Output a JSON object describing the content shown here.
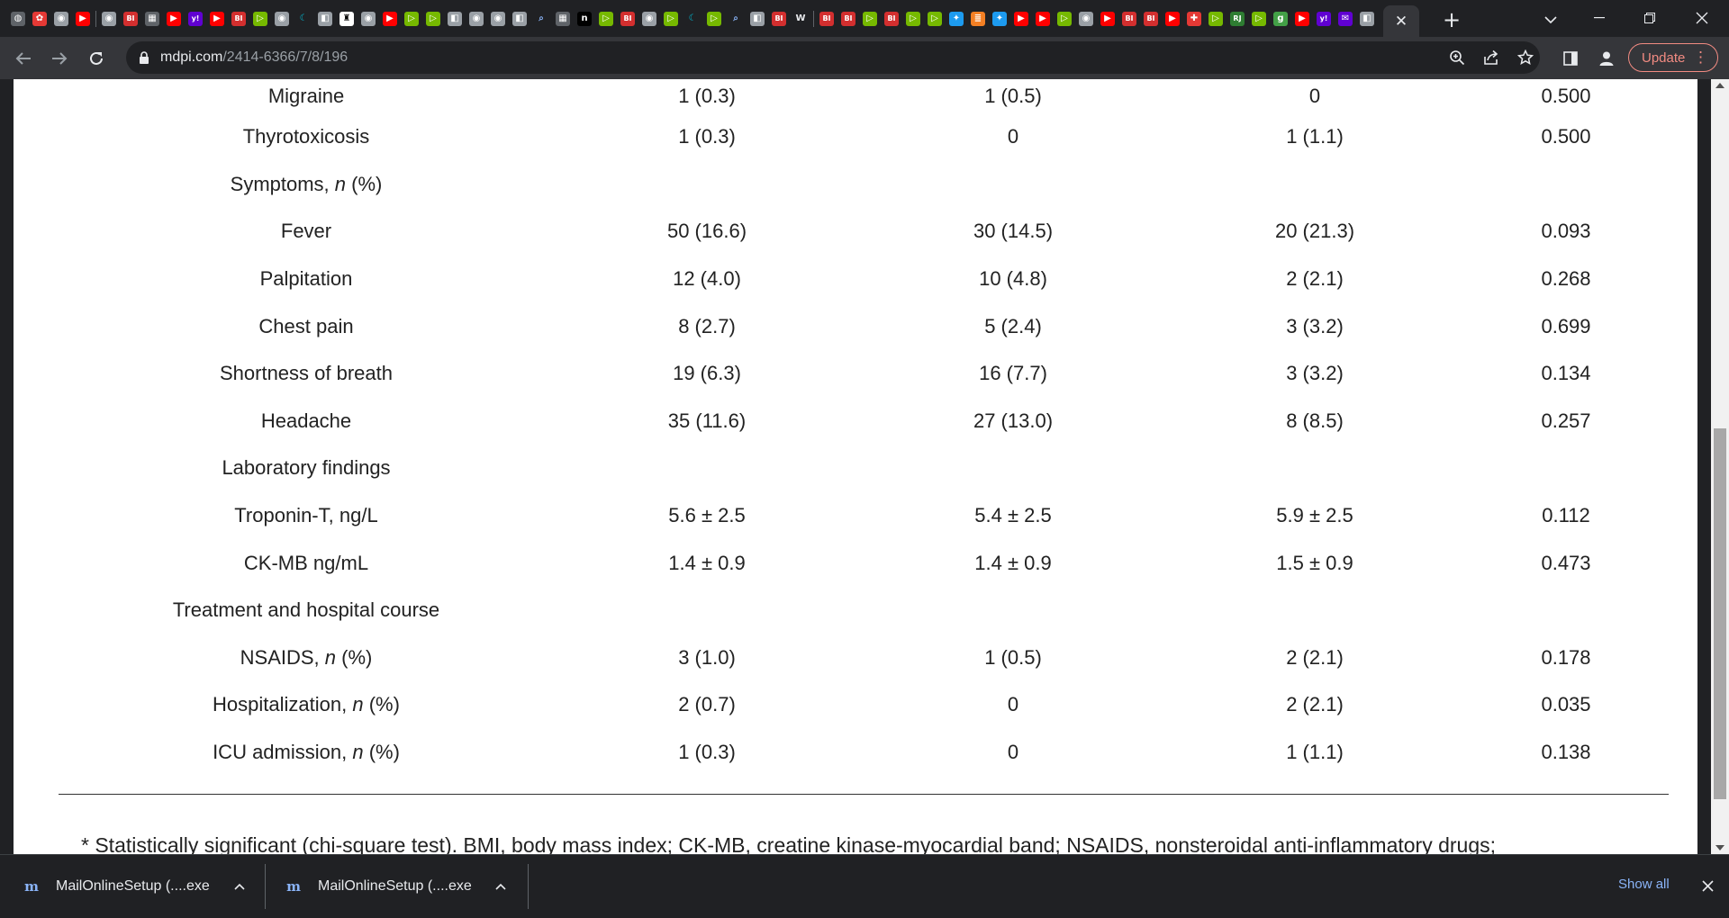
{
  "browser": {
    "tab_favicons": [
      {
        "name": "globe",
        "bg": "#5f6368",
        "glyph": "◍"
      },
      {
        "name": "flower",
        "bg": "#e53935",
        "glyph": "✿"
      },
      {
        "name": "chrome",
        "bg": "#9aa0a6",
        "glyph": "◉"
      },
      {
        "name": "youtube",
        "bg": "#ff0000",
        "glyph": "▶"
      },
      {
        "name": "sep"
      },
      {
        "name": "chrome",
        "bg": "#9aa0a6",
        "glyph": "◉"
      },
      {
        "name": "bi",
        "bg": "#d32f2f",
        "glyph": "BI"
      },
      {
        "name": "tablet",
        "bg": "#5f6368",
        "glyph": "▦"
      },
      {
        "name": "youtube",
        "bg": "#ff0000",
        "glyph": "▶"
      },
      {
        "name": "yahoo",
        "bg": "#6001d2",
        "glyph": "y!"
      },
      {
        "name": "youtube",
        "bg": "#ff0000",
        "glyph": "▶"
      },
      {
        "name": "bi",
        "bg": "#d32f2f",
        "glyph": "BI"
      },
      {
        "name": "play",
        "bg": "#76b900",
        "glyph": "▷"
      },
      {
        "name": "chrome",
        "bg": "#9aa0a6",
        "glyph": "◉"
      },
      {
        "name": "cyan",
        "bg": "#202124",
        "glyph": "☾"
      },
      {
        "name": "doc",
        "bg": "#9aa0a6",
        "glyph": "◧"
      },
      {
        "name": "chess",
        "bg": "#ffffff",
        "glyph": "♜"
      },
      {
        "name": "chrome",
        "bg": "#9aa0a6",
        "glyph": "◉"
      },
      {
        "name": "youtube",
        "bg": "#ff0000",
        "glyph": "▶"
      },
      {
        "name": "play",
        "bg": "#76b900",
        "glyph": "▷"
      },
      {
        "name": "play",
        "bg": "#76b900",
        "glyph": "▷"
      },
      {
        "name": "doc",
        "bg": "#9aa0a6",
        "glyph": "◧"
      },
      {
        "name": "chrome",
        "bg": "#9aa0a6",
        "glyph": "◉"
      },
      {
        "name": "chrome",
        "bg": "#9aa0a6",
        "glyph": "◉"
      },
      {
        "name": "doc",
        "bg": "#9aa0a6",
        "glyph": "◧"
      },
      {
        "name": "search",
        "bg": "#202124",
        "glyph": "⌕"
      },
      {
        "name": "tablet",
        "bg": "#5f6368",
        "glyph": "▦"
      },
      {
        "name": "n",
        "bg": "#000000",
        "glyph": "n"
      },
      {
        "name": "play",
        "bg": "#76b900",
        "glyph": "▷"
      },
      {
        "name": "bi",
        "bg": "#d32f2f",
        "glyph": "BI"
      },
      {
        "name": "chrome",
        "bg": "#9aa0a6",
        "glyph": "◉"
      },
      {
        "name": "play",
        "bg": "#76b900",
        "glyph": "▷"
      },
      {
        "name": "cyan",
        "bg": "#202124",
        "glyph": "☾"
      },
      {
        "name": "play",
        "bg": "#76b900",
        "glyph": "▷"
      },
      {
        "name": "search",
        "bg": "#202124",
        "glyph": "⌕"
      },
      {
        "name": "doc",
        "bg": "#9aa0a6",
        "glyph": "◧"
      },
      {
        "name": "bi",
        "bg": "#d32f2f",
        "glyph": "BI"
      },
      {
        "name": "wiki",
        "bg": "#202124",
        "glyph": "W"
      },
      {
        "name": "sep"
      },
      {
        "name": "bi",
        "bg": "#d32f2f",
        "glyph": "BI"
      },
      {
        "name": "bi",
        "bg": "#d32f2f",
        "glyph": "BI"
      },
      {
        "name": "play",
        "bg": "#76b900",
        "glyph": "▷"
      },
      {
        "name": "bi",
        "bg": "#d32f2f",
        "glyph": "BI"
      },
      {
        "name": "play",
        "bg": "#76b900",
        "glyph": "▷"
      },
      {
        "name": "play",
        "bg": "#76b900",
        "glyph": "▷"
      },
      {
        "name": "twitter",
        "bg": "#1d9bf0",
        "glyph": "✦"
      },
      {
        "name": "stack",
        "bg": "#f48024",
        "glyph": "≣"
      },
      {
        "name": "twitter",
        "bg": "#1d9bf0",
        "glyph": "✦"
      },
      {
        "name": "youtube",
        "bg": "#ff0000",
        "glyph": "▶"
      },
      {
        "name": "youtube",
        "bg": "#ff0000",
        "glyph": "▶"
      },
      {
        "name": "play",
        "bg": "#76b900",
        "glyph": "▷"
      },
      {
        "name": "chrome",
        "bg": "#9aa0a6",
        "glyph": "◉"
      },
      {
        "name": "youtube",
        "bg": "#ff0000",
        "glyph": "▶"
      },
      {
        "name": "bi",
        "bg": "#d32f2f",
        "glyph": "BI"
      },
      {
        "name": "bi",
        "bg": "#d32f2f",
        "glyph": "BI"
      },
      {
        "name": "youtube",
        "bg": "#ff0000",
        "glyph": "▶"
      },
      {
        "name": "puzzle",
        "bg": "#e53935",
        "glyph": "✚"
      },
      {
        "name": "play",
        "bg": "#76b900",
        "glyph": "▷"
      },
      {
        "name": "rj",
        "bg": "#2e7d32",
        "glyph": "RJ"
      },
      {
        "name": "play",
        "bg": "#76b900",
        "glyph": "▷"
      },
      {
        "name": "g",
        "bg": "#43a047",
        "glyph": "g"
      },
      {
        "name": "youtube",
        "bg": "#ff0000",
        "glyph": "▶"
      },
      {
        "name": "yahoo",
        "bg": "#6001d2",
        "glyph": "y!"
      },
      {
        "name": "mail",
        "bg": "#6001d2",
        "glyph": "✉"
      },
      {
        "name": "doc",
        "bg": "#9aa0a6",
        "glyph": "◧"
      }
    ],
    "active_tab_close": "✕",
    "new_tab": "+",
    "url_domain": "mdpi.com",
    "url_path": "/2414-6366/7/8/196",
    "update_label": "Update",
    "update_menu": "⋮"
  },
  "table": {
    "rows": [
      {
        "label": "Migraine",
        "label_italic": "",
        "label_suffix": "",
        "c1": "1 (0.3)",
        "c2": "1 (0.5)",
        "c3": "0",
        "p": "0.500"
      },
      {
        "label": "Thyrotoxicosis",
        "label_italic": "",
        "label_suffix": "",
        "c1": "1 (0.3)",
        "c2": "0",
        "c3": "1 (1.1)",
        "p": "0.500"
      },
      {
        "label": "Symptoms, ",
        "label_italic": "n",
        "label_suffix": " (%)",
        "c1": "",
        "c2": "",
        "c3": "",
        "p": ""
      },
      {
        "label": "Fever",
        "label_italic": "",
        "label_suffix": "",
        "c1": "50 (16.6)",
        "c2": "30 (14.5)",
        "c3": "20 (21.3)",
        "p": "0.093"
      },
      {
        "label": "Palpitation",
        "label_italic": "",
        "label_suffix": "",
        "c1": "12 (4.0)",
        "c2": "10 (4.8)",
        "c3": "2 (2.1)",
        "p": "0.268"
      },
      {
        "label": "Chest pain",
        "label_italic": "",
        "label_suffix": "",
        "c1": "8 (2.7)",
        "c2": "5 (2.4)",
        "c3": "3 (3.2)",
        "p": "0.699"
      },
      {
        "label": "Shortness of breath",
        "label_italic": "",
        "label_suffix": "",
        "c1": "19 (6.3)",
        "c2": "16 (7.7)",
        "c3": "3 (3.2)",
        "p": "0.134"
      },
      {
        "label": "Headache",
        "label_italic": "",
        "label_suffix": "",
        "c1": "35 (11.6)",
        "c2": "27 (13.0)",
        "c3": "8 (8.5)",
        "p": "0.257"
      },
      {
        "label": "Laboratory findings",
        "label_italic": "",
        "label_suffix": "",
        "c1": "",
        "c2": "",
        "c3": "",
        "p": ""
      },
      {
        "label": "Troponin-T, ng/L",
        "label_italic": "",
        "label_suffix": "",
        "c1": "5.6 ± 2.5",
        "c2": "5.4 ± 2.5",
        "c3": "5.9 ± 2.5",
        "p": "0.112"
      },
      {
        "label": "CK-MB ng/mL",
        "label_italic": "",
        "label_suffix": "",
        "c1": "1.4 ± 0.9",
        "c2": "1.4 ± 0.9",
        "c3": "1.5 ± 0.9",
        "p": "0.473"
      },
      {
        "label": "Treatment and hospital course",
        "label_italic": "",
        "label_suffix": "",
        "c1": "",
        "c2": "",
        "c3": "",
        "p": ""
      },
      {
        "label": "NSAIDS, ",
        "label_italic": "n",
        "label_suffix": " (%)",
        "c1": "3 (1.0)",
        "c2": "1 (0.5)",
        "c3": "2 (2.1)",
        "p": "0.178"
      },
      {
        "label": "Hospitalization, ",
        "label_italic": "n",
        "label_suffix": " (%)",
        "c1": "2 (0.7)",
        "c2": "0",
        "c3": "2 (2.1)",
        "p": "0.035"
      },
      {
        "label": "ICU admission, ",
        "label_italic": "n",
        "label_suffix": " (%)",
        "c1": "1 (0.3)",
        "c2": "0",
        "c3": "1 (1.1)",
        "p": "0.138"
      }
    ],
    "footnote": "* Statistically significant (chi-square test). BMI, body mass index; CK-MB, creatine kinase-myocardial band; NSAIDS, nonsteroidal anti-inflammatory drugs;"
  },
  "downloads": {
    "items": [
      {
        "name": "MailOnlineSetup (....exe",
        "icon": "m"
      },
      {
        "name": "MailOnlineSetup (....exe",
        "icon": "m"
      }
    ],
    "show_all": "Show all"
  }
}
